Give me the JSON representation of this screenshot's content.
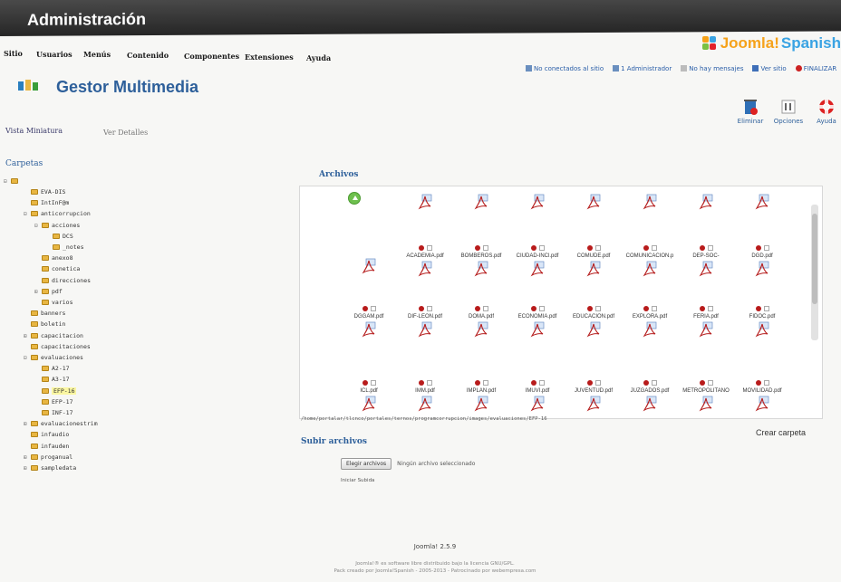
{
  "header": {
    "title": "Administración"
  },
  "menu": [
    "Sitio",
    "Usuarios",
    "Menús",
    "Contenido",
    "Componentes",
    "Extensiones",
    "Ayuda"
  ],
  "brand": {
    "name": "Joomla!",
    "suffix": "Spanish"
  },
  "status": {
    "not_connected": "No conectados al sitio",
    "admins": "1 Administrador",
    "messages": "No hay mensajes",
    "view_site": "Ver sitio",
    "logout": "FINALIZAR"
  },
  "page": {
    "title": "Gestor Multimedia"
  },
  "toolbar": {
    "delete": "Eliminar",
    "options": "Opciones",
    "help": "Ayuda"
  },
  "views": {
    "thumbnail": "Vista Miniatura",
    "details": "Ver Detalles"
  },
  "folders": {
    "title": "Carpetas",
    "items": [
      "EVA-DIS",
      "IntInF@m",
      "anticorrupcion",
      "acciones",
      "DCS",
      "_notes",
      "anexo8",
      "conetica",
      "direcciones",
      "pdf",
      "varios",
      "banners",
      "boletin",
      "capacitacion",
      "capacitaciones",
      "evaluaciones",
      "A2-17",
      "A3-17",
      "EFP-16",
      "EFP-17",
      "INF-17",
      "evaluacionestrim",
      "infaudio",
      "infauden",
      "proganual",
      "sampledata"
    ]
  },
  "files": {
    "title": "Archivos",
    "items": [
      "ACADEMIA.pdf",
      "BOMBEROS.pdf",
      "CIUDAD-INCl.pdf",
      "COMUDE.pdf",
      "COMUNICACION.p",
      "DEP-SOC-",
      "DGD.pdf",
      "DGGAM.pdf",
      "DIF-LEON.pdf",
      "DOMA.pdf",
      "ECONOMIA.pdf",
      "EDUCACION.pdf",
      "EXPLORA.pdf",
      "FERIA.pdf",
      "FIDOC.pdf",
      "ICL.pdf",
      "IMM.pdf",
      "IMPLAN.pdf",
      "IMUVI.pdf",
      "JUVENTUD.pdf",
      "JUZGADOS.pdf",
      "METROPOLITANO",
      "MOVILIDAD.pdf"
    ],
    "path": "/home/portalar/tlcnco/portales/ternos/programcorrupcion/images/evaluaciones/EFP-16",
    "create_folder": "Crear carpeta"
  },
  "upload": {
    "title": "Subir archivos",
    "choose": "Elegir archivos",
    "no_file": "Ningún archivo seleccionado",
    "start": "Iniciar Subida"
  },
  "footer": {
    "version": "Joomla! 2.5.9",
    "license": "Joomla!® es software libre distribuido bajo la licencia GNU/GPL.",
    "pack": "Pack creado por Joomla!Spanish - 2005-2013 - Patrocinado por webempresa.com"
  }
}
